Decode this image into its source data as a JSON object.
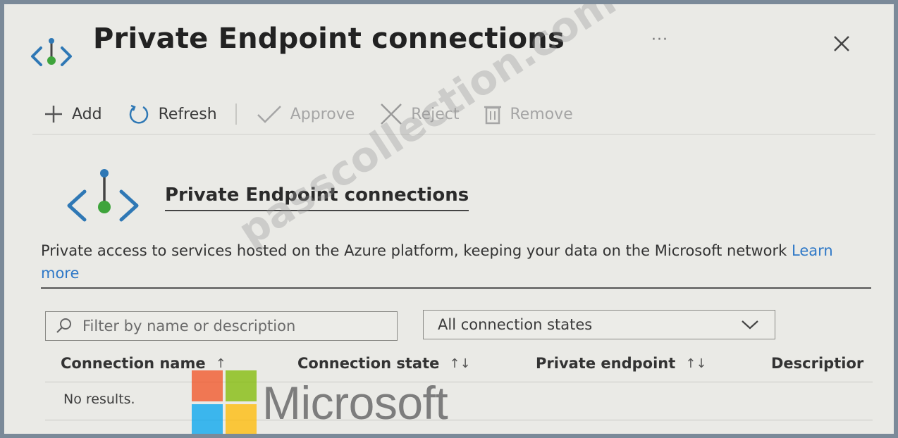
{
  "header": {
    "title": "Private Endpoint connections",
    "more_label": "···",
    "close_icon": "close-icon"
  },
  "toolbar": {
    "items": [
      {
        "label": "Add",
        "icon": "plus-icon",
        "enabled": true
      },
      {
        "label": "Refresh",
        "icon": "refresh-icon",
        "enabled": true
      },
      {
        "label": "Approve",
        "icon": "checkmark-icon",
        "enabled": false
      },
      {
        "label": "Reject",
        "icon": "x-icon",
        "enabled": false
      },
      {
        "label": "Remove",
        "icon": "trash-icon",
        "enabled": false
      }
    ]
  },
  "section": {
    "title": "Private Endpoint connections",
    "description": "Private access to services hosted on the Azure platform, keeping your data on the Microsoft network",
    "learn_more": "Learn more"
  },
  "filters": {
    "search_placeholder": "Filter by name or description",
    "state_value": "All connection states"
  },
  "table": {
    "columns": [
      {
        "label": "Connection name",
        "sort": "↑"
      },
      {
        "label": "Connection state",
        "sort": "↑↓"
      },
      {
        "label": "Private endpoint",
        "sort": "↑↓"
      },
      {
        "label": "Descriptior",
        "sort": ""
      }
    ],
    "empty_text": "No results."
  },
  "overlay": {
    "brand": "Microsoft",
    "watermark": "passcollection.com"
  },
  "colors": {
    "accent": "#2e78c7",
    "endpoint_icon_blue": "#2f78b5",
    "endpoint_icon_green": "#3ea43b",
    "ms_red": "#f25022",
    "ms_green": "#7fba00",
    "ms_blue": "#00a4ef",
    "ms_yellow": "#ffb900"
  }
}
